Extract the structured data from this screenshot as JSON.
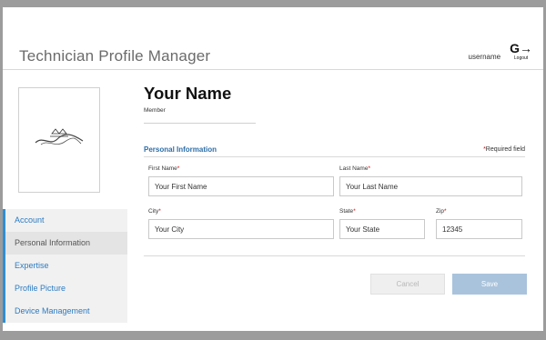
{
  "app": {
    "title": "Technician Profile Manager"
  },
  "user": {
    "username": "username",
    "logout_label": "Logout"
  },
  "profile": {
    "name": "Your Name",
    "role": "Member"
  },
  "sidebar": {
    "items": [
      {
        "label": "Account",
        "active": false
      },
      {
        "label": "Personal Information",
        "active": true
      },
      {
        "label": "Expertise",
        "active": false
      },
      {
        "label": "Profile Picture",
        "active": false
      },
      {
        "label": "Device Management",
        "active": false
      }
    ]
  },
  "section": {
    "title": "Personal Information",
    "required_note": "Required field"
  },
  "form": {
    "first_name": {
      "label": "First Name",
      "value": "Your First Name"
    },
    "last_name": {
      "label": "Last Name",
      "value": "Your Last Name"
    },
    "city": {
      "label": "City",
      "value": "Your City"
    },
    "state": {
      "label": "State",
      "value": "Your State"
    },
    "zip": {
      "label": "Zip",
      "value": "12345"
    }
  },
  "buttons": {
    "cancel": "Cancel",
    "save": "Save"
  },
  "colors": {
    "accent": "#2d8fd6",
    "section_title": "#2d6ea8",
    "save_button": "#a9c3dc",
    "required": "#dd0000"
  }
}
